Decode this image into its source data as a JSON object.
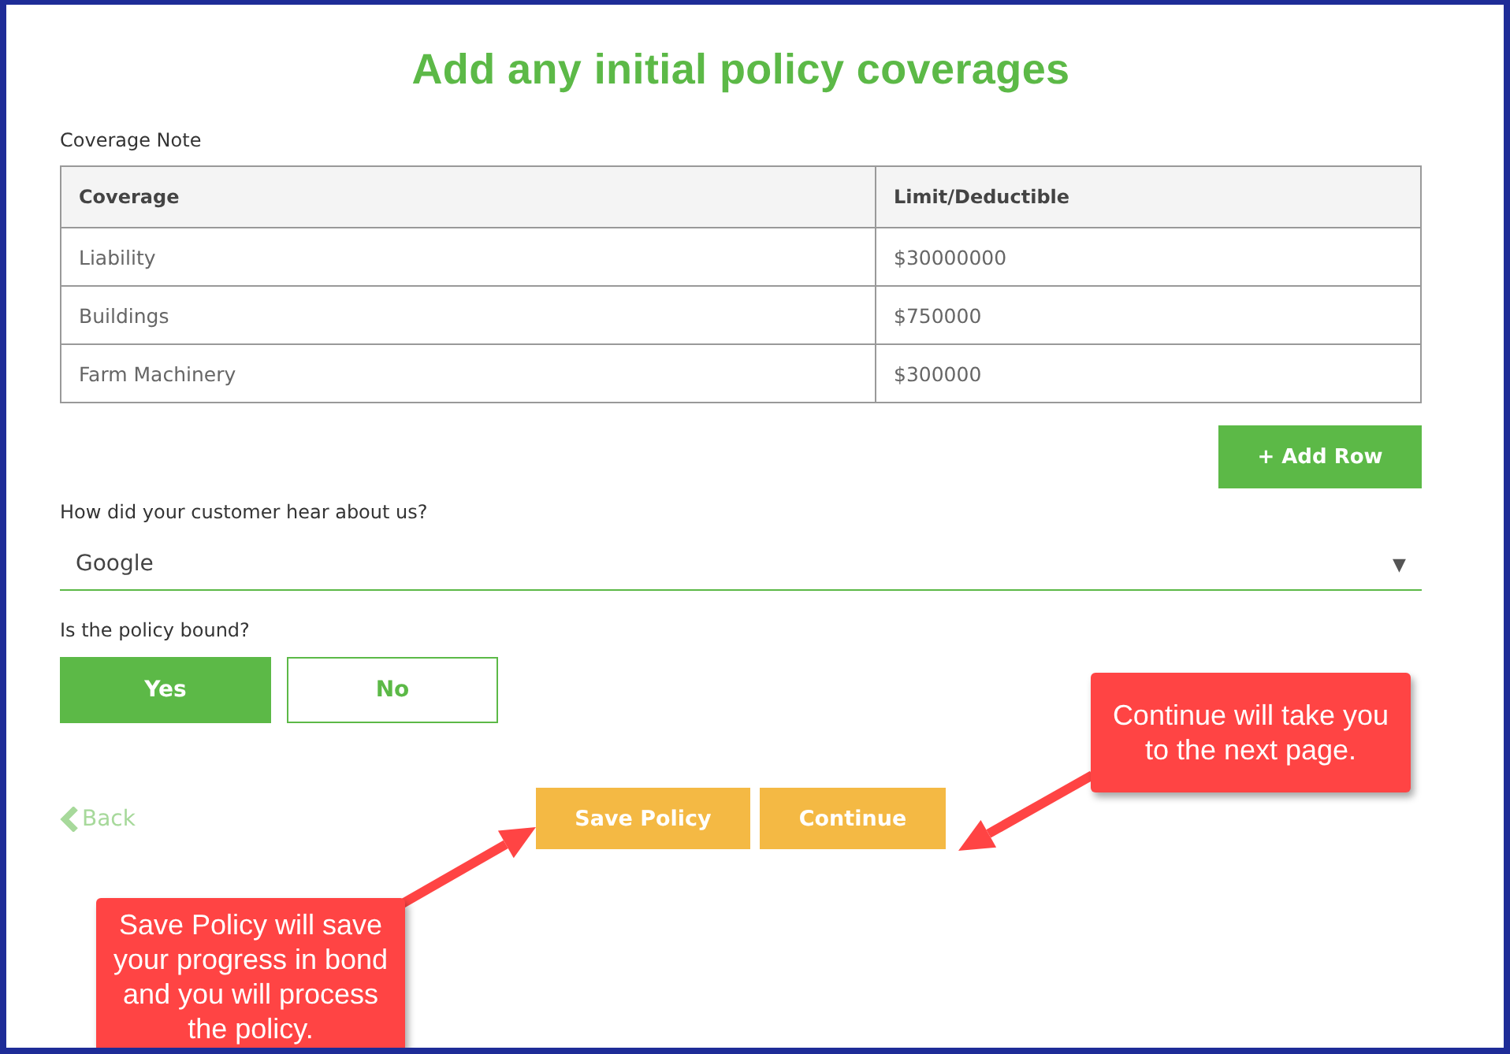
{
  "title": "Add any initial policy coverages",
  "coverage_note_label": "Coverage Note",
  "table": {
    "columns": [
      "Coverage",
      "Limit/Deductible"
    ],
    "rows": [
      [
        "Liability",
        "$30000000"
      ],
      [
        "Buildings",
        "$750000"
      ],
      [
        "Farm Machinery",
        "$300000"
      ]
    ]
  },
  "add_row_button": "+ Add Row",
  "referral": {
    "label": "How did your customer hear about us?",
    "value": "Google",
    "caret": "▼"
  },
  "bound": {
    "label": "Is the policy bound?",
    "options": [
      {
        "label": "Yes",
        "selected": true
      },
      {
        "label": "No",
        "selected": false
      }
    ]
  },
  "back_link": "Back",
  "buttons": [
    "Save Policy",
    "Continue"
  ],
  "callouts": [
    {
      "text": "Continue will take you to the next page."
    },
    {
      "text": "Save Policy will save your progress in bond and you will process the policy."
    }
  ]
}
